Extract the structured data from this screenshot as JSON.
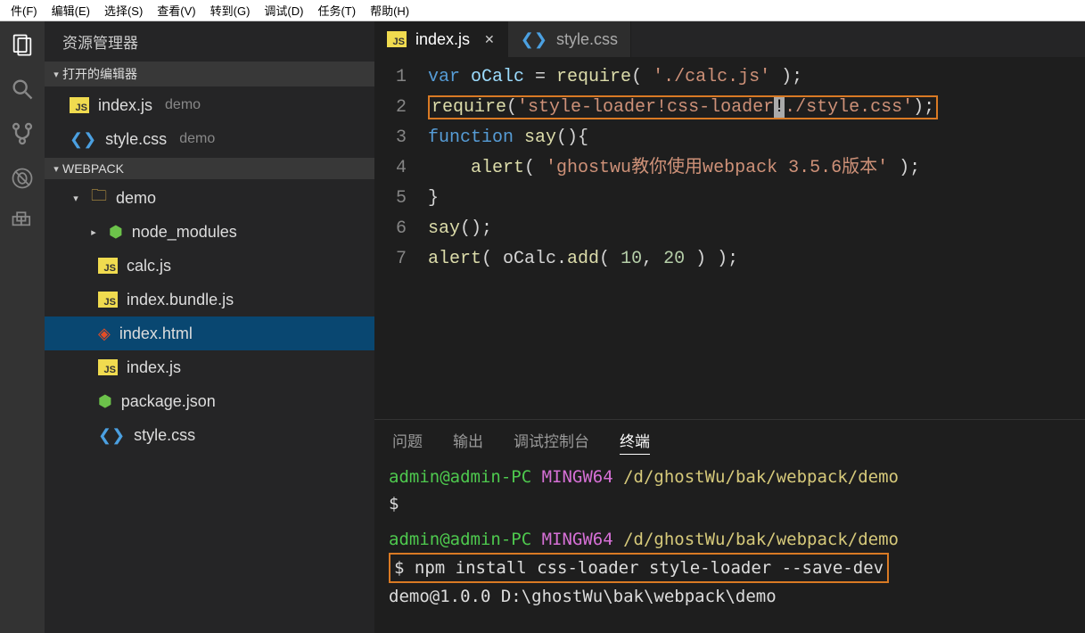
{
  "menu": [
    "件(F)",
    "编辑(E)",
    "选择(S)",
    "查看(V)",
    "转到(G)",
    "调试(D)",
    "任务(T)",
    "帮助(H)"
  ],
  "sidebar": {
    "title": "资源管理器",
    "sections": {
      "openEditors": {
        "label": "打开的编辑器"
      },
      "workspace": {
        "label": "WEBPACK"
      }
    },
    "openFiles": [
      {
        "name": "index.js",
        "dim": "demo",
        "icon": "js"
      },
      {
        "name": "style.css",
        "dim": "demo",
        "icon": "css"
      }
    ],
    "tree": {
      "demo": "demo",
      "files": [
        {
          "name": "node_modules",
          "icon": "node",
          "expandable": true
        },
        {
          "name": "calc.js",
          "icon": "js"
        },
        {
          "name": "index.bundle.js",
          "icon": "js"
        },
        {
          "name": "index.html",
          "icon": "html",
          "selected": true
        },
        {
          "name": "index.js",
          "icon": "js"
        },
        {
          "name": "package.json",
          "icon": "node"
        },
        {
          "name": "style.css",
          "icon": "css"
        }
      ]
    }
  },
  "tabs": [
    {
      "name": "index.js",
      "icon": "js",
      "active": true,
      "close": true
    },
    {
      "name": "style.css",
      "icon": "css",
      "active": false
    }
  ],
  "code": {
    "l1": {
      "ln": "1",
      "a": "var",
      "b": " oCalc ",
      "c": "=",
      "d": " require",
      "e": "( ",
      "f": "'./calc.js'",
      "g": " );"
    },
    "l2": {
      "ln": "2",
      "a": "require",
      "b": "(",
      "c": "'style-loader!css-loader",
      "d": "!",
      "e": "./style.css'",
      "f": ");"
    },
    "l3": {
      "ln": "3",
      "a": "function",
      "b": " say",
      "c": "(){"
    },
    "l4": {
      "ln": "4",
      "a": "    alert",
      "b": "( ",
      "c": "'ghostwu教你使用webpack 3.5.6版本'",
      "d": " );"
    },
    "l5": {
      "ln": "5",
      "a": "}"
    },
    "l6": {
      "ln": "6",
      "a": "say",
      "b": "();"
    },
    "l7": {
      "ln": "7",
      "a": "alert",
      "b": "( oCalc.",
      "c": "add",
      "d": "( ",
      "e": "10",
      "f": ", ",
      "g": "20",
      "h": " ) );"
    }
  },
  "panel": {
    "tabs": [
      "问题",
      "输出",
      "调试控制台",
      "终端"
    ],
    "active": 3,
    "term": {
      "l1a": "admin@admin-PC",
      "l1b": " MINGW64",
      "l1c": " /d/ghostWu/bak/webpack/demo",
      "l2": "$",
      "l3a": "admin@admin-PC",
      "l3b": " MINGW64",
      "l3c": " /d/ghostWu/bak/webpack/demo",
      "l4": "$ npm install css-loader style-loader --save-dev",
      "l5": "demo@1.0.0 D:\\ghostWu\\bak\\webpack\\demo"
    }
  }
}
